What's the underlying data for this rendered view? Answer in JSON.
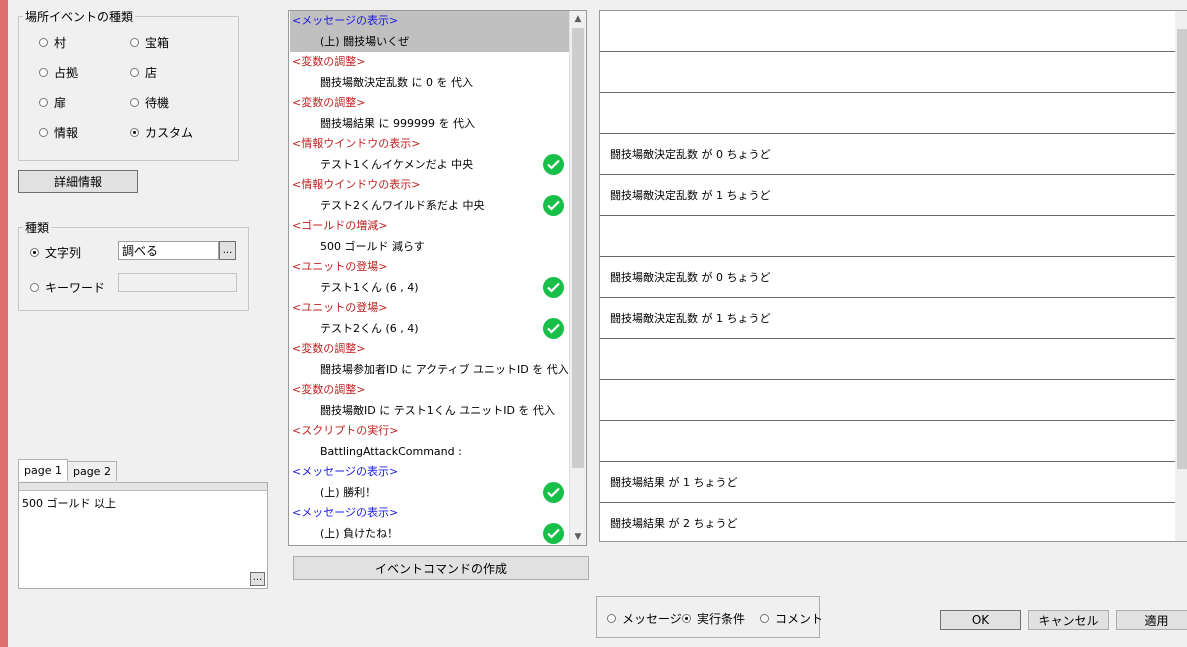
{
  "location_group": {
    "legend": "場所イベントの種類",
    "options": [
      {
        "label": "村",
        "selected": false
      },
      {
        "label": "宝箱",
        "selected": false
      },
      {
        "label": "占拠",
        "selected": false
      },
      {
        "label": "店",
        "selected": false
      },
      {
        "label": "扉",
        "selected": false
      },
      {
        "label": "待機",
        "selected": false
      },
      {
        "label": "情報",
        "selected": false
      },
      {
        "label": "カスタム",
        "selected": true
      }
    ]
  },
  "detail_button": "詳細情報",
  "type_group": {
    "legend": "種類",
    "string_label": "文字列",
    "string_value": "調べる",
    "string_selected": true,
    "keyword_label": "キーワード",
    "keyword_selected": false,
    "browse_label": "..."
  },
  "tabs": [
    "page 1",
    "page 2"
  ],
  "active_tab": "page 1",
  "page_condition": "500 ゴールド 以上",
  "memo_browse": "...",
  "command_list": [
    {
      "kind": "cmd",
      "text": "<メッセージの表示>",
      "color": "#1a1ae6",
      "selected": true
    },
    {
      "kind": "detail",
      "text": "(上) 闘技場いくぜ",
      "selected": true
    },
    {
      "kind": "cmd",
      "text": "<変数の調整>",
      "color": "#c02020"
    },
    {
      "kind": "detail",
      "text": "闘技場敵決定乱数 に 0 を 代入"
    },
    {
      "kind": "cmd",
      "text": "<変数の調整>",
      "color": "#c02020"
    },
    {
      "kind": "detail",
      "text": "闘技場結果 に 999999 を 代入"
    },
    {
      "kind": "cmd",
      "text": "<情報ウインドウの表示>",
      "color": "#c02020"
    },
    {
      "kind": "detail",
      "text": "テスト1くんイケメンだよ 中央",
      "check": true
    },
    {
      "kind": "cmd",
      "text": "<情報ウインドウの表示>",
      "color": "#c02020"
    },
    {
      "kind": "detail",
      "text": "テスト2くんワイルド系だよ 中央",
      "check": true
    },
    {
      "kind": "cmd",
      "text": "<ゴールドの増減>",
      "color": "#c02020"
    },
    {
      "kind": "detail",
      "text": "500 ゴールド 減らす"
    },
    {
      "kind": "cmd",
      "text": "<ユニットの登場>",
      "color": "#c02020"
    },
    {
      "kind": "detail",
      "text": "テスト1くん (6 , 4)",
      "check": true
    },
    {
      "kind": "cmd",
      "text": "<ユニットの登場>",
      "color": "#c02020"
    },
    {
      "kind": "detail",
      "text": "テスト2くん (6 , 4)",
      "check": true
    },
    {
      "kind": "cmd",
      "text": "<変数の調整>",
      "color": "#c02020"
    },
    {
      "kind": "detail",
      "text": "闘技場参加者ID に アクティブ ユニットID を 代入"
    },
    {
      "kind": "cmd",
      "text": "<変数の調整>",
      "color": "#c02020"
    },
    {
      "kind": "detail",
      "text": "闘技場敵ID に テスト1くん ユニットID を 代入"
    },
    {
      "kind": "cmd",
      "text": "<スクリプトの実行>",
      "color": "#c02020"
    },
    {
      "kind": "detail",
      "text": "BattlingAttackCommand :"
    },
    {
      "kind": "cmd",
      "text": "<メッセージの表示>",
      "color": "#1a1ae6"
    },
    {
      "kind": "detail",
      "text": "(上) 勝利！",
      "check": true
    },
    {
      "kind": "cmd",
      "text": "<メッセージの表示>",
      "color": "#1a1ae6"
    },
    {
      "kind": "detail",
      "text": "(上) 負けたね！",
      "check": true
    }
  ],
  "create_command_button": "イベントコマンドの作成",
  "condition_list": [
    "",
    "",
    "",
    "闘技場敵決定乱数 が 0 ちょうど",
    "闘技場敵決定乱数 が 1 ちょうど",
    "",
    "闘技場敵決定乱数 が 0 ちょうど",
    "闘技場敵決定乱数 が 1 ちょうど",
    "",
    "",
    "",
    "闘技場結果 が 1 ちょうど",
    "闘技場結果 が 2 ちょうど"
  ],
  "mode": {
    "options": [
      {
        "label": "メッセージ",
        "selected": false
      },
      {
        "label": "実行条件",
        "selected": true
      },
      {
        "label": "コメント",
        "selected": false
      }
    ]
  },
  "buttons": {
    "ok": "OK",
    "cancel": "キャンセル",
    "apply": "適用"
  }
}
